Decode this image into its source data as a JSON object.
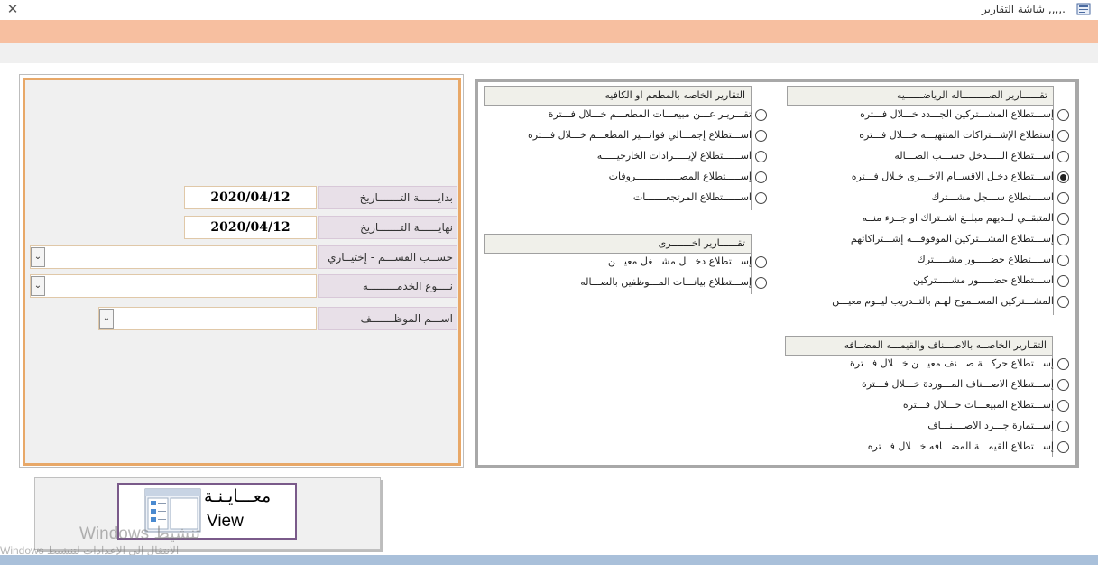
{
  "window": {
    "title": ".,,,, شاشة التقارير",
    "close_glyph": "✕"
  },
  "filters": {
    "start_date_label": "بدايــــــة التـــــــاريخ",
    "start_date_value": "2020/04/12",
    "end_date_label": "نهايــــــة التـــــــاريخ",
    "end_date_value": "2020/04/12",
    "department_label": "حســب القســـم - إختيــاري",
    "service_type_label": "نــــوع الخدمـــــــــه",
    "employee_label": "اســـم الموظـــــــف",
    "dropdown_glyph": "⌄"
  },
  "sections": {
    "sports": {
      "header": "تقــــــارير الصـــــــــاله الرياضــــــيه",
      "options": [
        "إســـتطلاع المشـــتركين الجـــدد خـــلال فـــتره",
        "إستطلاع الإشـــتراكات المنتهيـــه خـــلال فـــتره",
        "اســـتطلاع الـــــدخل حســـب الصـــاله",
        "اســـتطلاع دخـل الاقســام الاخـــرى خـلال فـــتره",
        "اســــتطلاع ســـجل مشـــترك",
        "المتبقــي لــديهم مبلــغ اشــتراك او جــزء منــه",
        "إســـتطلاع المشـــتركين الموقوفـــه إشـــتراكاتهم",
        "اســــتطلاع حضـــــور مشـــــترك",
        "اســـتطلاع حضـــــور مشـــــتركين",
        "المشـــتركين المســموح لهـم بالتــدريب ليــوم معيـــن"
      ],
      "selected_index": 3
    },
    "restaurant": {
      "header": "التقارير الخاصه بالمطعم او الكافيه",
      "options": [
        "تقـــريـر عـــن مبيعـــات المطعـــم خـــلال فـــترة",
        "اســـتطلاع إجمـــالي فواتـــير المطعـــم خـــلال فـــتره",
        "اســــــتطلاع لإيـــــرادات الخارجيـــــه",
        "إســـــتطلاع المصـــــــــــــــروفات",
        "اســــــتطلاع المرتجعـــــــات"
      ]
    },
    "other": {
      "header": "تقــــــارير اخـــــــرى",
      "options": [
        "إســـتطلاع دخـــل مشـــغل معيـــن",
        "إســـتطلاع بيانـــات المـــوظفين بالصـــاله"
      ]
    },
    "items": {
      "header": "التقـارير الخاصــه بالاصـــناف والقيمـــه المضــافه",
      "options": [
        "إســـتطلاع حركـــة صـــنف معيـــن خـــلال فـــترة",
        "إســـتطلاع الاصـــناف المـــوردة خـــلال فـــترة",
        "إســـتطلاع المبيعـــات خـــلال فـــترة",
        "إســـتمارة جـــرد الاصــــنـــاف",
        "إســـتطلاع القيمـــة المضـــافه خـــلال فـــتره"
      ]
    }
  },
  "view_button": {
    "label_ar": "معـــايـنـة",
    "label_en": "View"
  },
  "watermark": {
    "line1": "Windows تنشيط",
    "line2": "Windows الانتقال إلى الإعدادات لتنشيط"
  },
  "colors": {
    "accent_band": "#f7bfa0",
    "panel_border": "#e8a868",
    "bottom_band": "#a9c0da"
  }
}
